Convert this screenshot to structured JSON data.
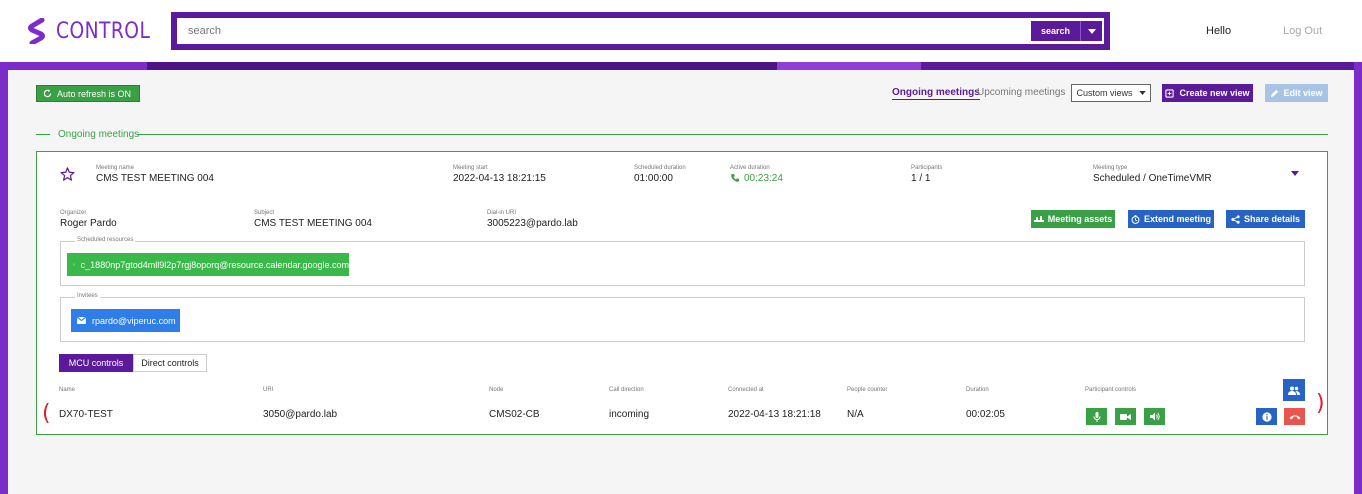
{
  "app": {
    "name": "CONTROL"
  },
  "header": {
    "search_placeholder": "search",
    "search_button": "search",
    "greeting": "Hello",
    "logout": "Log Out"
  },
  "toolbar": {
    "auto_refresh": "Auto refresh is ON",
    "tabs": [
      {
        "label": "Ongoing meetings",
        "active": true
      },
      {
        "label": "Upcoming meetings",
        "active": false
      }
    ],
    "custom_views": "Custom views",
    "create_view": "Create new view",
    "edit_view": "Edit view"
  },
  "section": {
    "title": "Ongoing meetings"
  },
  "meeting": {
    "fields": [
      {
        "label": "Meeting name",
        "value": "CMS TEST MEETING 004"
      },
      {
        "label": "Meeting start",
        "value": "2022-04-13 18:21:15"
      },
      {
        "label": "Scheduled duration",
        "value": "01:00:00"
      },
      {
        "label": "Active duration",
        "value": "00:23:24"
      },
      {
        "label": "Participants",
        "value": "1 / 1"
      },
      {
        "label": "Meeting type",
        "value": "Scheduled / OneTimeVMR"
      }
    ],
    "details": [
      {
        "label": "Organizer",
        "value": "Roger Pardo"
      },
      {
        "label": "Subject",
        "value": "CMS TEST MEETING 004"
      },
      {
        "label": "Dial-in URI",
        "value": "3005223@pardo.lab"
      }
    ],
    "actions": {
      "assets": "Meeting assets",
      "extend": "Extend meeting",
      "share": "Share details"
    },
    "scheduled_resources": {
      "legend": "Scheduled resources",
      "items": [
        "c_1880np7gtod4mll9l2p7rgj8oporq@resource.calendar.google.com"
      ]
    },
    "invitees": {
      "legend": "Invitees",
      "items": [
        "rpardo@viperuc.com"
      ]
    },
    "control_tabs": [
      {
        "label": "MCU controls",
        "active": true
      },
      {
        "label": "Direct controls",
        "active": false
      }
    ],
    "participants_table": {
      "columns": [
        "Name",
        "URI",
        "Node",
        "Call direction",
        "Connected at",
        "People counter",
        "Duration",
        "Participant controls"
      ],
      "rows": [
        {
          "name": "DX70-TEST",
          "uri": "3050@pardo.lab",
          "node": "CMS02-CB",
          "direction": "incoming",
          "connected_at": "2022-04-13 18:21:18",
          "people_counter": "N/A",
          "duration": "00:02:05"
        }
      ]
    }
  },
  "colors": {
    "brand_purple": "#5a1a9a",
    "accent_purple": "#7b2cc9",
    "green": "#3aa046",
    "blue": "#2763c4",
    "red": "#e9544e"
  }
}
